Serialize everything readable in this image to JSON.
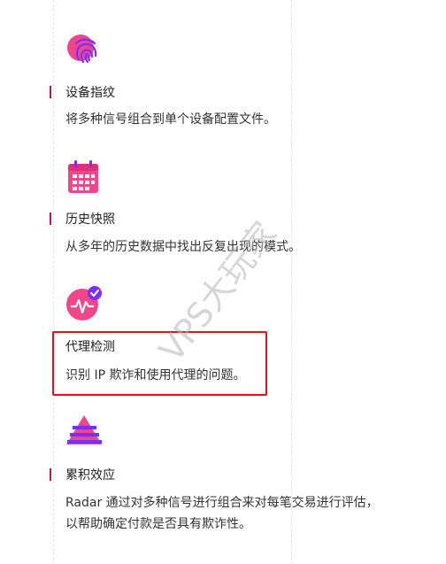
{
  "features": [
    {
      "icon": "fingerprint-icon",
      "title": "设备指纹",
      "description": "将多种信号组合到单个设备配置文件。"
    },
    {
      "icon": "calendar-icon",
      "title": "历史快照",
      "description": "从多年的历史数据中找出反复出现的模式。"
    },
    {
      "icon": "heartbeat-check-icon",
      "title": "代理检测",
      "description": "识别 IP 欺诈和使用代理的问题。"
    },
    {
      "icon": "pyramid-icon",
      "title": "累积效应",
      "description_line1": "Radar 通过对多种信号进行组合来对每笔交易进行评估，",
      "description_line2": "以帮助确定付款是否具有欺诈性。"
    }
  ],
  "watermark": "VPS大玩家",
  "colors": {
    "accent": "#b0147f",
    "pink": "#f2468c",
    "purple": "#7b2ff7",
    "highlight": "#e3101b"
  }
}
